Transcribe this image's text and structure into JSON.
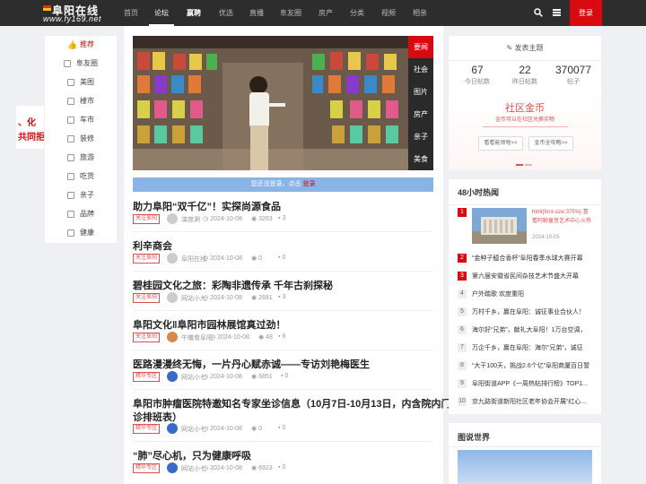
{
  "site": {
    "name": "阜阳在线",
    "url": "www.fy169.net"
  },
  "nav": {
    "items": [
      "首页",
      "论坛",
      "嬴聘",
      "优选",
      "直播",
      "阜友圈",
      "房产",
      "分类",
      "视频",
      "相亲"
    ],
    "login": "登录"
  },
  "leftnav": {
    "items": [
      "推荐",
      "阜友圈",
      "美图",
      "楼市",
      "车市",
      "装修",
      "旅游",
      "吃货",
      "亲子",
      "品牌",
      "健康"
    ]
  },
  "sidead": {
    "line1": "、化",
    "line2": "共同拒"
  },
  "hero_tabs": [
    "要闻",
    "社会",
    "图片",
    "房产",
    "亲子",
    "美食"
  ],
  "notice": {
    "text": "您还没登录，点击",
    "link": "登录"
  },
  "posts": [
    {
      "title": "助力阜阳“双千亿”！实探尚源食品",
      "tag": "关注阜阳",
      "author": "滦度涮",
      "date": "2024-10-08",
      "views": "3263",
      "comments": "3"
    },
    {
      "title": "利辛商会",
      "tag": "关注阜阳",
      "author": "阜阳在线",
      "date": "2024-10-08",
      "views": "0",
      "comments": "0"
    },
    {
      "title": "碧桂园文化之旅：彩陶非遗传承 千年古刹探秘",
      "tag": "关注阜阳",
      "author": "网站小九",
      "date": "2024-10-08",
      "views": "2681",
      "comments": "3"
    },
    {
      "title": "阜阳文化‖阜阳市园林展馆真过劲！",
      "tag": "关注阜阳",
      "author": "午曦看阜阳",
      "date": "2024-10-08",
      "views": "48",
      "comments": "6"
    },
    {
      "title": "医路漫漫终无悔，一片丹心赋赤诚——专访刘艳梅医生",
      "tag": "精华专区",
      "author": "网站小七",
      "date": "2024-10-08",
      "views": "6851",
      "comments": "0"
    },
    {
      "title": "阜阳市肿瘤医院特邀知名专家坐诊信息（10月7日-10月13日，内含院内门",
      "title2": "诊排班表）",
      "tag": "精华专区",
      "author": "网站小七",
      "date": "2024-10-08",
      "views": "0",
      "comments": "0"
    },
    {
      "title": "“肺”尽心机，只为健康呼吸",
      "tag": "精华专区",
      "author": "网站小七",
      "date": "2024-10-08",
      "views": "6923",
      "comments": "0"
    }
  ],
  "right": {
    "post_btn": "发表主题",
    "stats": [
      {
        "n": "67",
        "l": "今日帖数"
      },
      {
        "n": "22",
        "l": "昨日帖数"
      },
      {
        "n": "370077",
        "l": "帖子"
      }
    ],
    "mall_title": "社区金币",
    "mall_sub": "金币可以在社区兑换实物",
    "btn1": "看看能领啥>>",
    "btn2": "金币全攻略>>"
  },
  "hot": {
    "title": "48小时热闻",
    "first": {
      "num": "1",
      "text": "html{font-size:375%} 喜看阿聊童音艺术中心火热",
      "date": "2024-10-05"
    },
    "items": [
      {
        "num": "2",
        "text": "“金种子醯合香杯”阜阳春季水球大赛开幕"
      },
      {
        "num": "3",
        "text": "第六届安徽省民间杂技艺术节盛大开幕"
      },
      {
        "num": "4",
        "text": "户外踏歌 欢度重阳"
      },
      {
        "num": "5",
        "text": "万村千乡，赢在阜阳：诚征事业合伙人！"
      },
      {
        "num": "6",
        "text": "海尔好“兄弟”，献礼大阜阳！1万台空调，"
      },
      {
        "num": "7",
        "text": "万企千乡，赢在阜阳：海尔“兄弟”，诚征"
      },
      {
        "num": "8",
        "text": "“大干100天，挑战2.6个亿”阜阳商厦百日誓"
      },
      {
        "num": "9",
        "text": "阜阳街道APP《一周热帖排行榜》TOP1..."
      },
      {
        "num": "10",
        "text": "京九路街道新阳社区老年协会开展“红心..."
      }
    ]
  },
  "world": {
    "title": "图说世界"
  }
}
